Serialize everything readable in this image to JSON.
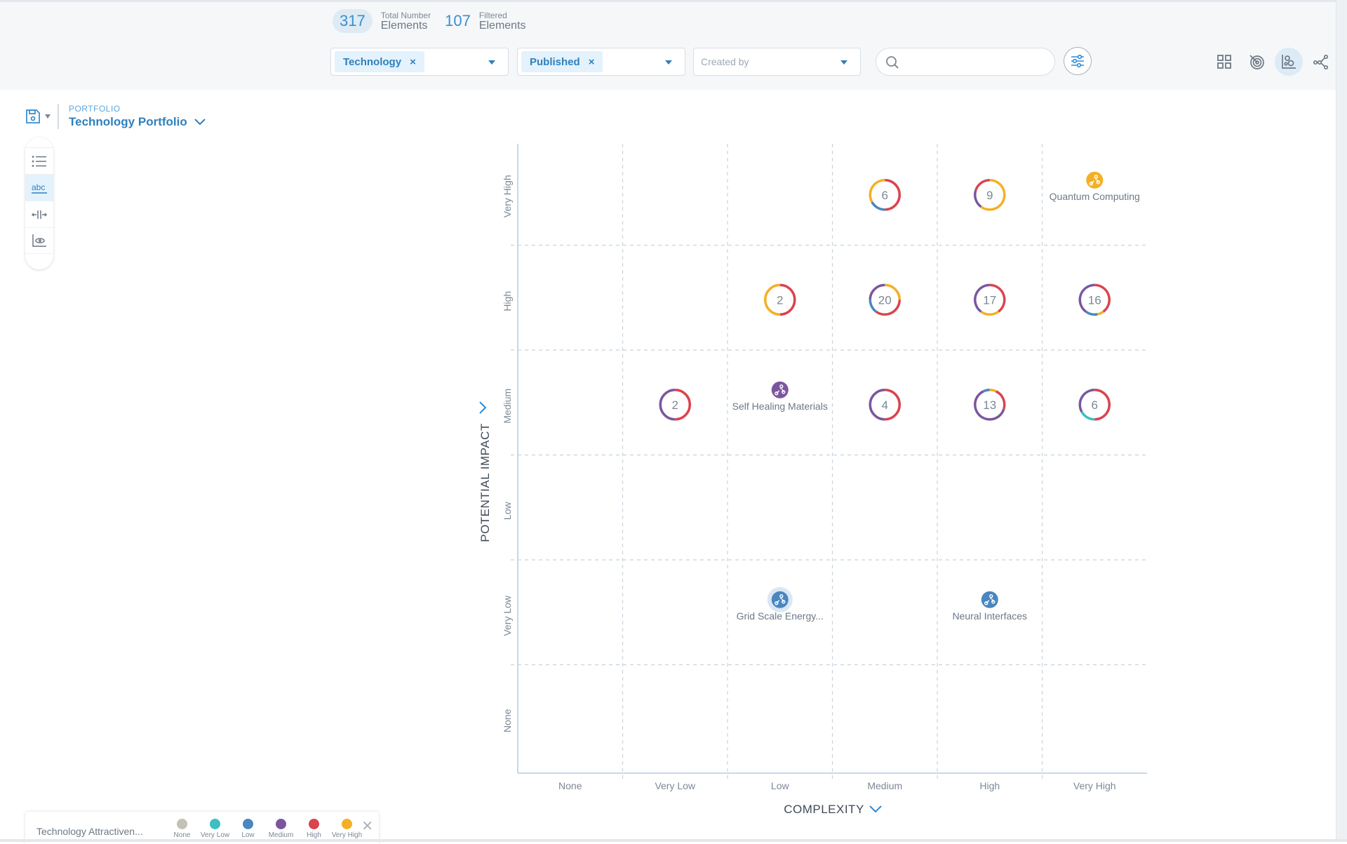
{
  "header": {
    "total_count": "317",
    "total_label_small": "Total Number",
    "total_label_big": "Elements",
    "filtered_count": "107",
    "filtered_label_small": "Filtered",
    "filtered_label_big": "Elements"
  },
  "filters": {
    "type_chip": "Technology",
    "status_chip": "Published",
    "created_by_placeholder": "Created by",
    "search_placeholder": ""
  },
  "view_icons": [
    {
      "name": "grid-view-icon",
      "active": false
    },
    {
      "name": "radar-view-icon",
      "active": false
    },
    {
      "name": "matrix-view-icon",
      "active": true
    },
    {
      "name": "network-view-icon",
      "active": false
    }
  ],
  "portfolio": {
    "label": "PORTFOLIO",
    "name": "Technology Portfolio"
  },
  "tools": [
    {
      "name": "list-icon",
      "active": false
    },
    {
      "name": "label-abc-icon",
      "active": true
    },
    {
      "name": "spacing-icon",
      "active": false
    },
    {
      "name": "chart-view-icon",
      "active": false
    }
  ],
  "legend": {
    "title": "Technology Attractiven...",
    "items": [
      {
        "label": "None",
        "color": "#c4c2b4"
      },
      {
        "label": "Very Low",
        "color": "#3dbfbf"
      },
      {
        "label": "Low",
        "color": "#4a86c0"
      },
      {
        "label": "Medium",
        "color": "#7b569f"
      },
      {
        "label": "High",
        "color": "#d9444f"
      },
      {
        "label": "Very High",
        "color": "#f4b024"
      }
    ]
  },
  "chart_data": {
    "type": "scatter",
    "title": "",
    "xlabel": "COMPLEXITY",
    "ylabel": "POTENTIAL IMPACT",
    "x_categories": [
      "None",
      "Very Low",
      "Low",
      "Medium",
      "High",
      "Very High"
    ],
    "y_categories": [
      "None",
      "Very Low",
      "Low",
      "Medium",
      "High",
      "Very High"
    ],
    "grid": true,
    "color_scale_name": "Technology Attractiveness",
    "color_scale": {
      "None": "#c4c2b4",
      "Very Low": "#3dbfbf",
      "Low": "#4a86c0",
      "Medium": "#7b569f",
      "High": "#d9444f",
      "Very High": "#f4b024"
    },
    "clusters": [
      {
        "x": "Medium",
        "y": "Very High",
        "count": 6,
        "segments": [
          {
            "level": "High",
            "share": 0.5
          },
          {
            "level": "Low",
            "share": 0.17
          },
          {
            "level": "Very High",
            "share": 0.33
          }
        ]
      },
      {
        "x": "High",
        "y": "Very High",
        "count": 9,
        "segments": [
          {
            "level": "Very High",
            "share": 0.6
          },
          {
            "level": "Medium",
            "share": 0.2
          },
          {
            "level": "High",
            "share": 0.2
          }
        ]
      },
      {
        "x": "Low",
        "y": "High",
        "count": 2,
        "segments": [
          {
            "level": "High",
            "share": 0.5
          },
          {
            "level": "Very High",
            "share": 0.5
          }
        ]
      },
      {
        "x": "Medium",
        "y": "High",
        "count": 20,
        "segments": [
          {
            "level": "Very High",
            "share": 0.25
          },
          {
            "level": "High",
            "share": 0.35
          },
          {
            "level": "Low",
            "share": 0.15
          },
          {
            "level": "Medium",
            "share": 0.25
          }
        ]
      },
      {
        "x": "High",
        "y": "High",
        "count": 17,
        "segments": [
          {
            "level": "High",
            "share": 0.4
          },
          {
            "level": "Very High",
            "share": 0.2
          },
          {
            "level": "Medium",
            "share": 0.4
          }
        ]
      },
      {
        "x": "Very High",
        "y": "High",
        "count": 16,
        "segments": [
          {
            "level": "High",
            "share": 0.4
          },
          {
            "level": "Very High",
            "share": 0.07
          },
          {
            "level": "Low",
            "share": 0.13
          },
          {
            "level": "Medium",
            "share": 0.4
          }
        ]
      },
      {
        "x": "Very Low",
        "y": "Medium",
        "count": 2,
        "segments": [
          {
            "level": "High",
            "share": 0.5
          },
          {
            "level": "Medium",
            "share": 0.5
          }
        ]
      },
      {
        "x": "Medium",
        "y": "Medium",
        "count": 4,
        "segments": [
          {
            "level": "High",
            "share": 0.5
          },
          {
            "level": "Medium",
            "share": 0.5
          }
        ]
      },
      {
        "x": "High",
        "y": "Medium",
        "count": 13,
        "segments": [
          {
            "level": "Very High",
            "share": 0.07
          },
          {
            "level": "High",
            "share": 0.23
          },
          {
            "level": "Medium",
            "share": 0.63
          },
          {
            "level": "Low",
            "share": 0.07
          }
        ]
      },
      {
        "x": "Very High",
        "y": "Medium",
        "count": 6,
        "segments": [
          {
            "level": "High",
            "share": 0.5
          },
          {
            "level": "Very Low",
            "share": 0.17
          },
          {
            "level": "Medium",
            "share": 0.33
          }
        ]
      }
    ],
    "items": [
      {
        "x": "Very High",
        "y": "Very High",
        "label": "Quantum Computing",
        "level": "Very High",
        "highlighted": false
      },
      {
        "x": "Low",
        "y": "Medium",
        "label": "Self Healing Materials",
        "level": "Medium",
        "highlighted": false
      },
      {
        "x": "Low",
        "y": "Very Low",
        "label": "Grid Scale Energy...",
        "level": "Low",
        "highlighted": true
      },
      {
        "x": "High",
        "y": "Very Low",
        "label": "Neural Interfaces",
        "level": "Low",
        "highlighted": false
      }
    ]
  }
}
